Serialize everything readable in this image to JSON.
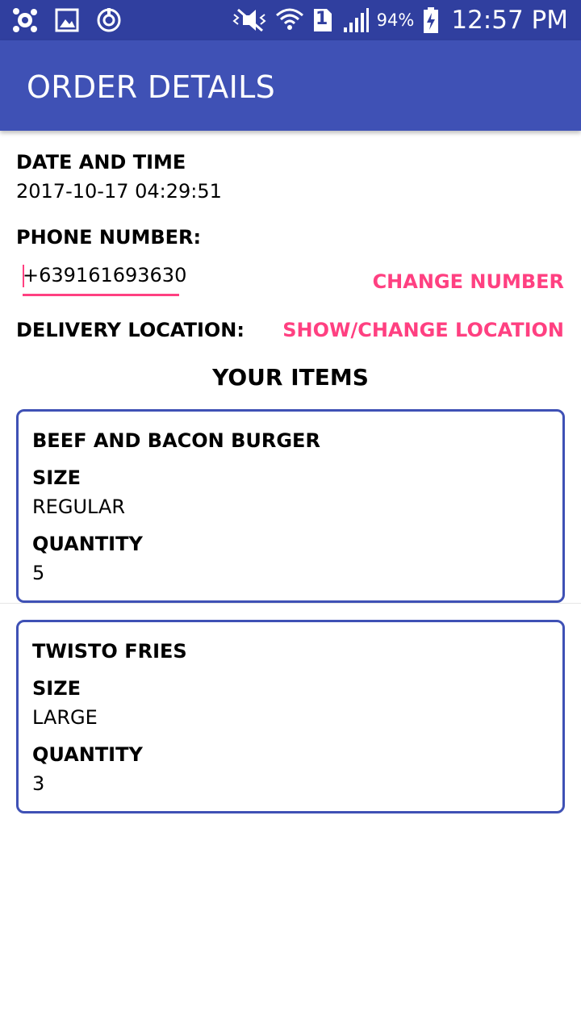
{
  "status_bar": {
    "battery_percent": "94%",
    "time": "12:57 PM",
    "sim_slot": "1"
  },
  "app_bar": {
    "title": "ORDER DETAILS"
  },
  "order": {
    "date_label": "DATE AND TIME",
    "date_value": "2017-10-17 04:29:51",
    "phone_label": "PHONE NUMBER:",
    "phone_value": "+639161693630",
    "change_number_label": "CHANGE NUMBER",
    "location_label": "DELIVERY LOCATION:",
    "change_location_label": "SHOW/CHANGE LOCATION"
  },
  "items_title": "YOUR ITEMS",
  "items": [
    {
      "name": "BEEF AND BACON BURGER",
      "size_label": "SIZE",
      "size": "REGULAR",
      "qty_label": "QUANTITY",
      "qty": "5"
    },
    {
      "name": "TWISTO FRIES",
      "size_label": "SIZE",
      "size": "LARGE",
      "qty_label": "QUANTITY",
      "qty": "3"
    }
  ],
  "colors": {
    "status_bar": "#303f9f",
    "app_bar": "#3f51b5",
    "accent": "#ff4081",
    "card_border": "#3f51b5"
  }
}
